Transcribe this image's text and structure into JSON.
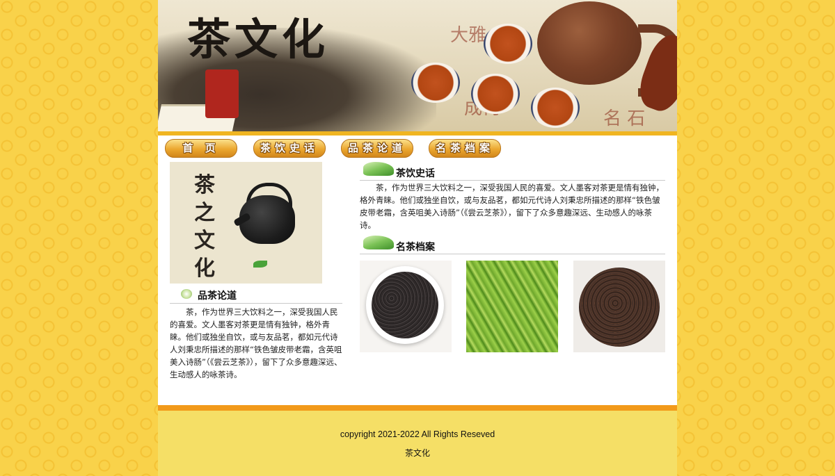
{
  "banner": {
    "title": "茶文化"
  },
  "nav": [
    {
      "label": "首 页"
    },
    {
      "label": "茶饮史话"
    },
    {
      "label": "品茶论道"
    },
    {
      "label": "名茶档案"
    }
  ],
  "feature_image": {
    "text": [
      "茶",
      "之",
      "文",
      "化"
    ]
  },
  "left_section": {
    "title": "品茶论道",
    "text": "茶，作为世界三大饮料之一，深受我国人民的喜爱。文人墨客对茶更是情有独钟，格外青睐。他们或独坐自饮，或与友品茗，都如元代诗人刘秉忠所描述的那样“铁色皱皮带老霜，含英咀美入诗肠”（《尝云芝茶》），留下了众多意趣深远、生动感人的咏茶诗。"
  },
  "history_section": {
    "title": "茶饮史话",
    "text": "茶，作为世界三大饮料之一，深受我国人民的喜爱。文人墨客对茶更是情有独钟，格外青睐。他们或独坐自饮，或与友品茗，都如元代诗人刘秉忠所描述的那样“铁色皱皮带老霜，含英咀美入诗肠”（《尝云芝茶》），留下了众多意趣深远、生动感人的咏茶诗。"
  },
  "archive_section": {
    "title": "名茶档案"
  },
  "footer": {
    "copyright": "copyright 2021-2022 All Rights Reseved",
    "brand": "茶文化"
  }
}
